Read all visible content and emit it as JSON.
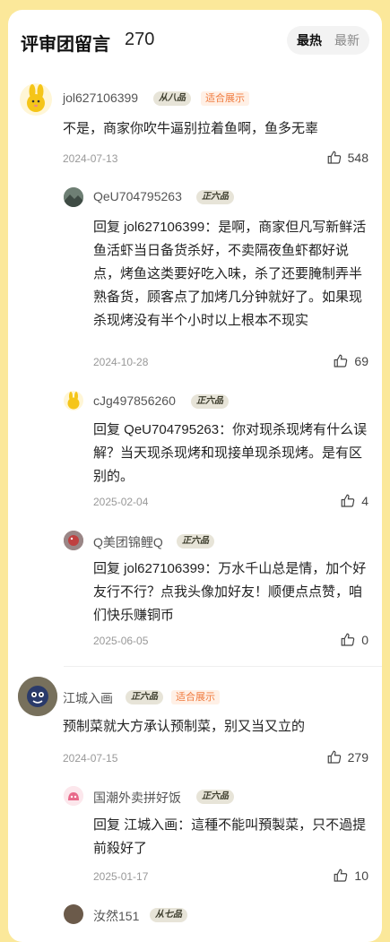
{
  "header": {
    "title": "评审团留言",
    "count": "270",
    "sort_hot": "最热",
    "sort_new": "最新"
  },
  "comments": [
    {
      "user": "jol627106399",
      "badge": "从八品",
      "tag": "适合展示",
      "text": "不是，商家你吹牛逼别拉着鱼啊，鱼多无辜",
      "date": "2024-07-13",
      "likes": "548",
      "replies": [
        {
          "user": "QeU704795263",
          "badge": "正六品",
          "text": "回复 jol627106399：是啊，商家但凡写新鲜活鱼活虾当日备货杀好，不卖隔夜鱼虾都好说点，烤鱼这类要好吃入味，杀了还要腌制弄半熟备货，顾客点了加烤几分钟就好了。如果现杀现烤没有半个小时以上根本不现实",
          "date": "2024-10-28",
          "likes": "69"
        },
        {
          "user": "cJg497856260",
          "badge": "正六品",
          "text": "回复 QeU704795263：你对现杀现烤有什么误解？当天现杀现烤和现接单现杀现烤。是有区别的。",
          "date": "2025-02-04",
          "likes": "4"
        },
        {
          "user": "Q美团锦鲤Q",
          "badge": "正六品",
          "text": "回复 jol627106399：万水千山总是情，加个好友行不行？点我头像加好友！顺便点点赞，咱们快乐赚铜币",
          "date": "2025-06-05",
          "likes": "0"
        }
      ]
    },
    {
      "user": "江城入画",
      "badge": "正六品",
      "tag": "适合展示",
      "text": "预制菜就大方承认预制菜，别又当又立的",
      "date": "2024-07-15",
      "likes": "279",
      "replies": [
        {
          "user": "国潮外卖拼好饭",
          "badge": "正六品",
          "text": "回复 江城入画：這種不能叫預製菜，只不過提前殺好了",
          "date": "2025-01-17",
          "likes": "10"
        },
        {
          "user": "汝然151",
          "badge": "从七品"
        }
      ]
    }
  ]
}
